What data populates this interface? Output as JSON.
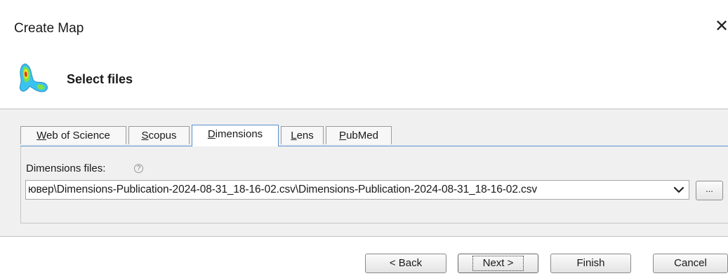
{
  "window": {
    "title": "Create Map",
    "close_glyph": "✕"
  },
  "header": {
    "title": "Select files",
    "icon": "density-map-icon"
  },
  "tabs": [
    {
      "prefix": "",
      "mnemonic": "W",
      "rest": "eb of Science",
      "active": false
    },
    {
      "prefix": "",
      "mnemonic": "S",
      "rest": "copus",
      "active": false
    },
    {
      "prefix": "",
      "mnemonic": "D",
      "rest": "imensions",
      "active": true
    },
    {
      "prefix": "",
      "mnemonic": "L",
      "rest": "ens",
      "active": false
    },
    {
      "prefix": "",
      "mnemonic": "P",
      "rest": "ubMed",
      "active": false
    }
  ],
  "files": {
    "label": "Dimensions files:",
    "help_glyph": "?",
    "value": "ювер\\Dimensions-Publication-2024-08-31_18-16-02.csv\\Dimensions-Publication-2024-08-31_18-16-02.csv",
    "browse_label": "..."
  },
  "buttons": {
    "back": "< Back",
    "next": "Next >",
    "finish": "Finish",
    "cancel": "Cancel"
  }
}
